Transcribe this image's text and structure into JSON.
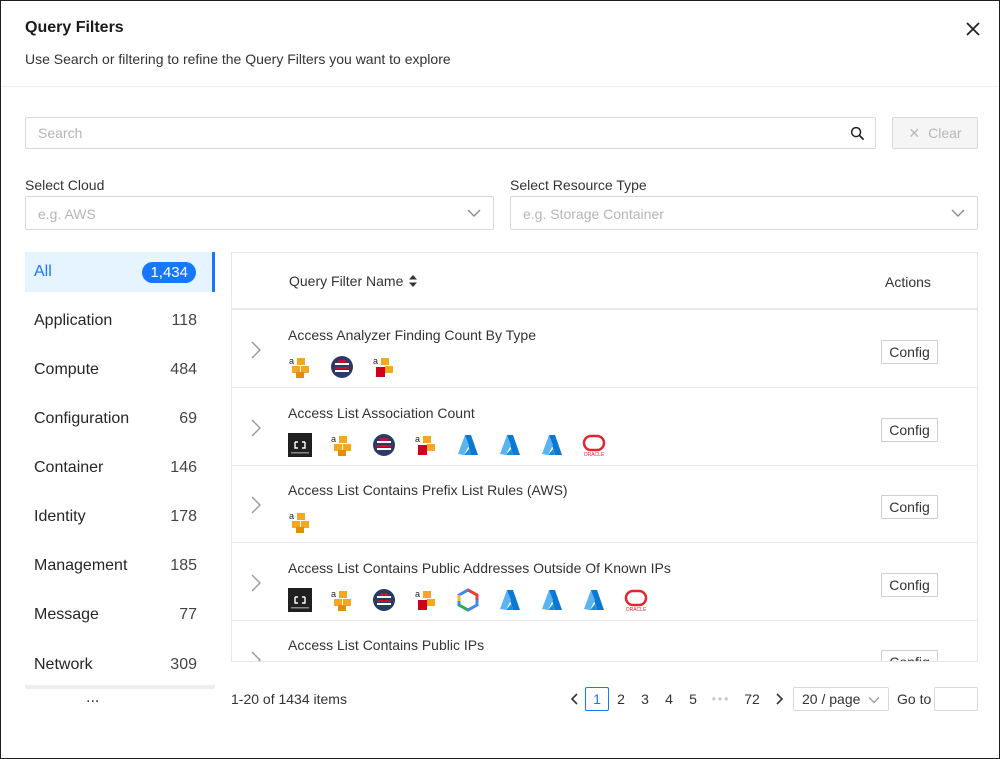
{
  "dialog": {
    "title": "Query Filters",
    "subtitle": "Use Search or filtering to refine the Query Filters you want to explore",
    "close_icon": "close-icon"
  },
  "search": {
    "placeholder": "Search",
    "value": "",
    "icon": "search-icon",
    "clear_label": "Clear"
  },
  "filters": {
    "cloud_label": "Select Cloud",
    "cloud_placeholder": "e.g. AWS",
    "resource_label": "Select Resource Type",
    "resource_placeholder": "e.g. Storage Container"
  },
  "categories": [
    {
      "label": "All",
      "count": "1,434",
      "active": true
    },
    {
      "label": "Application",
      "count": "118"
    },
    {
      "label": "Compute",
      "count": "484"
    },
    {
      "label": "Configuration",
      "count": "69"
    },
    {
      "label": "Container",
      "count": "146"
    },
    {
      "label": "Identity",
      "count": "178"
    },
    {
      "label": "Management",
      "count": "185"
    },
    {
      "label": "Message",
      "count": "77"
    },
    {
      "label": "Network",
      "count": "309"
    }
  ],
  "categories_more": "...",
  "table": {
    "col_name": "Query Filter Name",
    "col_actions": "Actions",
    "config_label": "Config",
    "rows": [
      {
        "name": "Access Analyzer Finding Count By Type",
        "clouds": [
          "aws",
          "gov",
          "aws-gov"
        ]
      },
      {
        "name": "Access List Association Count",
        "clouds": [
          "alibaba",
          "aws",
          "gov",
          "aws-gov",
          "azure",
          "azure",
          "azure",
          "oracle"
        ]
      },
      {
        "name": "Access List Contains Prefix List Rules (AWS)",
        "clouds": [
          "aws"
        ]
      },
      {
        "name": "Access List Contains Public Addresses Outside Of Known IPs",
        "clouds": [
          "alibaba",
          "aws",
          "gov",
          "aws-gov",
          "gcp",
          "azure",
          "azure",
          "azure",
          "oracle"
        ]
      },
      {
        "name": "Access List Contains Public IPs",
        "clouds": []
      }
    ]
  },
  "pagination": {
    "summary": "1-20 of 1434 items",
    "pages": [
      "1",
      "2",
      "3",
      "4",
      "5"
    ],
    "current": "1",
    "ellipsis": "•••",
    "last": "72",
    "page_size": "20 / page",
    "goto_label": "Go to"
  },
  "colors": {
    "accent": "#1677ff",
    "active_bg": "#e6f4ff",
    "aws": "#f5a623",
    "azure": "#0a78d4",
    "oracle": "#e3262d"
  }
}
